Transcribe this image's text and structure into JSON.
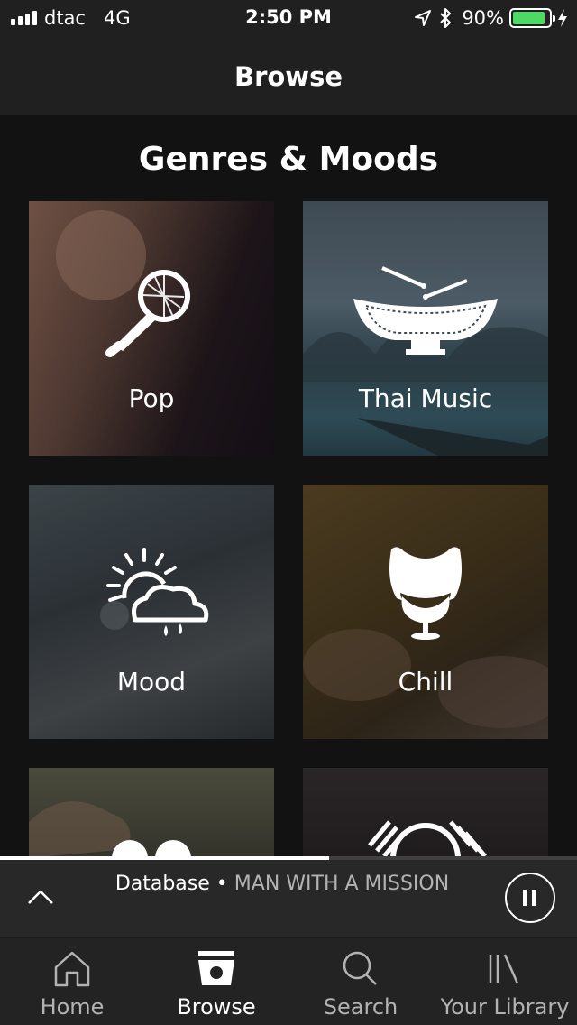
{
  "status_bar": {
    "carrier": "dtac",
    "network": "4G",
    "time": "2:50 PM",
    "battery_percent": "90%",
    "battery_level": 0.9,
    "battery_color": "#4cd964",
    "icons": [
      "signal-icon",
      "location-arrow-icon",
      "bluetooth-icon",
      "battery-icon",
      "charging-bolt-icon"
    ]
  },
  "header": {
    "title": "Browse"
  },
  "section": {
    "title": "Genres & Moods"
  },
  "tiles": [
    {
      "label": "Pop",
      "icon": "microphone-icon"
    },
    {
      "label": "Thai Music",
      "icon": "thai-drum-icon"
    },
    {
      "label": "Mood",
      "icon": "sun-cloud-rain-icon"
    },
    {
      "label": "Chill",
      "icon": "egg-chair-icon"
    },
    {
      "label": "",
      "icon": "hearts-icon"
    },
    {
      "label": "",
      "icon": "korean-flag-icon"
    }
  ],
  "now_playing": {
    "track": "Database",
    "separator": "•",
    "artist": "MAN WITH A MISSION",
    "progress": 0.57,
    "icons": [
      "chevron-up-icon",
      "pause-icon"
    ]
  },
  "tab_bar": {
    "tabs": [
      {
        "label": "Home",
        "icon": "home-icon",
        "active": false
      },
      {
        "label": "Browse",
        "icon": "browse-icon",
        "active": true
      },
      {
        "label": "Search",
        "icon": "search-icon",
        "active": false
      },
      {
        "label": "Your Library",
        "icon": "library-icon",
        "active": false
      }
    ]
  }
}
